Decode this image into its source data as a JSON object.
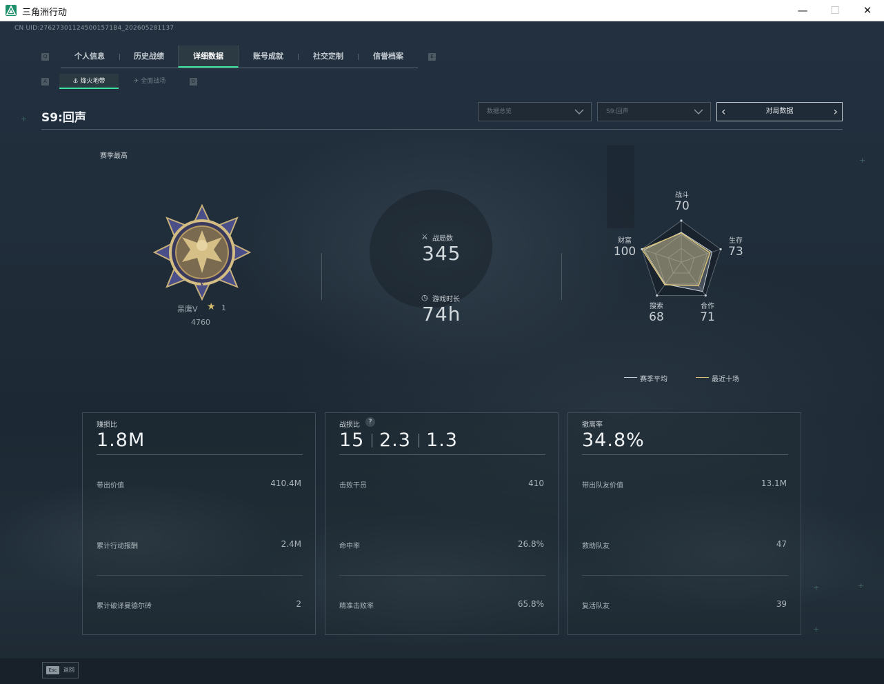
{
  "window": {
    "title": "三角洲行动",
    "controls": {
      "minimize": "—",
      "maximize": "☐",
      "close": "✕"
    }
  },
  "header": {
    "cn_uid": "CN UID:276273011245001571B4_202605281137",
    "tabs": [
      {
        "label": "个人信息",
        "active": false
      },
      {
        "label": "历史战绩",
        "active": false
      },
      {
        "label": "详细数据",
        "active": true
      },
      {
        "label": "账号成就",
        "active": false
      },
      {
        "label": "社交定制",
        "active": false
      },
      {
        "label": "信誉档案",
        "active": false
      }
    ],
    "tab_key_left": "Q",
    "tab_key_right": "E",
    "subtabs": [
      {
        "label": "烽火地带",
        "active": true
      },
      {
        "label": "全面战场",
        "active": false
      }
    ],
    "subtab_key_left": "A",
    "subtab_key_right": "D"
  },
  "filters": {
    "season_title": "S9:回声",
    "dropdown_data": "数据总览",
    "dropdown_season": "S9:回声",
    "match_data_label": "对局数据"
  },
  "overview": {
    "season_best_label": "赛季最高",
    "rank": {
      "name": "黑鹰V",
      "stars": "1",
      "score": "4760"
    },
    "matches": {
      "label": "战局数",
      "value": "345"
    },
    "playtime": {
      "label": "游戏时长",
      "value": "74h"
    }
  },
  "radar": {
    "axes": [
      {
        "label": "战斗",
        "value": 70
      },
      {
        "label": "生存",
        "value": 73
      },
      {
        "label": "合作",
        "value": 71
      },
      {
        "label": "搜索",
        "value": 68
      },
      {
        "label": "财富",
        "value": 100
      }
    ],
    "season_avg": [
      72,
      78,
      88,
      66,
      95
    ],
    "legend": {
      "season_avg": "赛季平均",
      "recent_ten": "最近十场"
    },
    "colors": {
      "season_avg": "#c9d0d5",
      "recent_ten": "#d8c27a"
    }
  },
  "cards": [
    {
      "label": "赚损比",
      "value": "1.8M",
      "rows": [
        {
          "label": "带出价值",
          "value": "410.4M"
        },
        {
          "label": "累计行动报酬",
          "value": "2.4M"
        },
        {
          "label": "累计破译曼德尔砖",
          "value": "2"
        }
      ]
    },
    {
      "label": "战损比",
      "value_parts": [
        "15",
        "2.3",
        "1.3"
      ],
      "help": "?",
      "rows": [
        {
          "label": "击败干员",
          "value": "410"
        },
        {
          "label": "命中率",
          "value": "26.8%"
        },
        {
          "label": "精准击败率",
          "value": "65.8%"
        }
      ]
    },
    {
      "label": "撤离率",
      "value": "34.8%",
      "rows": [
        {
          "label": "带出队友价值",
          "value": "13.1M"
        },
        {
          "label": "救助队友",
          "value": "47"
        },
        {
          "label": "复活队友",
          "value": "39"
        }
      ]
    }
  ],
  "footer": {
    "esc_key": "Esc",
    "esc_label": "返回"
  },
  "colors": {
    "accent": "#3ee2a0",
    "background": "#1b2631",
    "gold": "#d8c27a"
  }
}
